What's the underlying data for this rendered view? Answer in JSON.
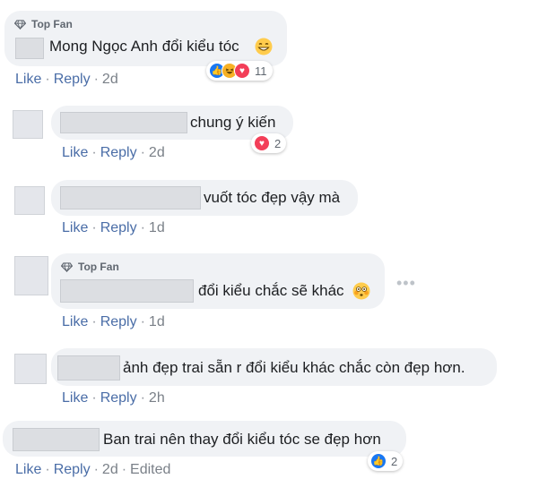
{
  "colors": {
    "link": "#4a6da7",
    "bubble": "#f0f2f5",
    "like_blue": "#1877f2",
    "love_red": "#f33e58",
    "haha_yellow": "#f7b125"
  },
  "comments": [
    {
      "badge": "Top Fan",
      "text": "Mong Ngọc Anh đổi kiểu tóc",
      "emoji": "grin-icon",
      "actions": {
        "like": "Like",
        "reply": "Reply",
        "time": "2d"
      },
      "reactions": {
        "icons": [
          "like-icon",
          "haha-icon",
          "love-icon"
        ],
        "count": "11"
      }
    },
    {
      "text": "chung ý kiến",
      "actions": {
        "like": "Like",
        "reply": "Reply",
        "time": "2d"
      },
      "reactions": {
        "icons": [
          "love-icon"
        ],
        "count": "2"
      }
    },
    {
      "text": "vuốt tóc đẹp vậy mà",
      "actions": {
        "like": "Like",
        "reply": "Reply",
        "time": "1d"
      }
    },
    {
      "badge": "Top Fan",
      "text": "đổi kiểu chắc sẽ khác",
      "emoji": "flushed-icon",
      "actions": {
        "like": "Like",
        "reply": "Reply",
        "time": "1d"
      },
      "more": "•••"
    },
    {
      "text": "ảnh đẹp trai sẵn r đổi kiểu khác chắc còn đẹp hơn.",
      "actions": {
        "like": "Like",
        "reply": "Reply",
        "time": "2h"
      }
    },
    {
      "text": "Ban trai nên thay đổi kiểu tóc se đẹp hơn",
      "actions": {
        "like": "Like",
        "reply": "Reply",
        "time": "2d",
        "edited": "Edited"
      },
      "reactions": {
        "icons": [
          "like-icon"
        ],
        "count": "2"
      }
    }
  ]
}
